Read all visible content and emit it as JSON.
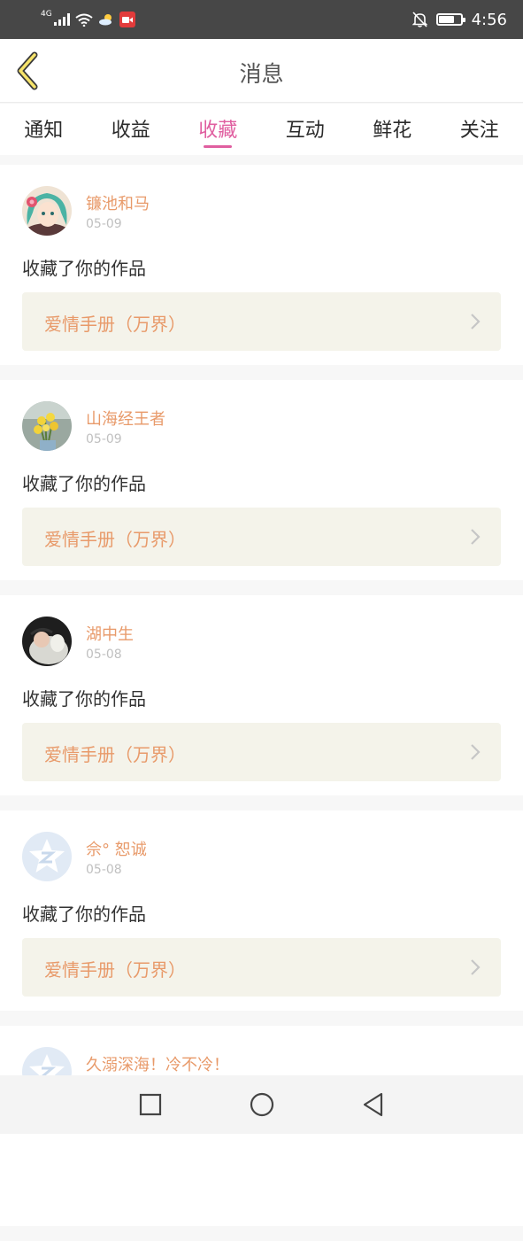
{
  "status_bar": {
    "network": "4G",
    "time": "4:56",
    "battery_level": 0.7
  },
  "header": {
    "title": "消息"
  },
  "tabs": [
    {
      "label": "通知",
      "active": false
    },
    {
      "label": "收益",
      "active": false
    },
    {
      "label": "收藏",
      "active": true
    },
    {
      "label": "互动",
      "active": false
    },
    {
      "label": "鲜花",
      "active": false
    },
    {
      "label": "关注",
      "active": false
    }
  ],
  "messages": [
    {
      "username": "镰池和马",
      "date": "05-09",
      "action": "收藏了你的作品",
      "work_title": "爱情手册（万界）",
      "avatar": "anime-girl"
    },
    {
      "username": "山海经王者",
      "date": "05-09",
      "action": "收藏了你的作品",
      "work_title": "爱情手册（万界）",
      "avatar": "flowers"
    },
    {
      "username": "湖中生",
      "date": "05-08",
      "action": "收藏了你的作品",
      "work_title": "爱情手册（万界）",
      "avatar": "baby-photo"
    },
    {
      "username": "佘° 恕诚",
      "date": "05-08",
      "action": "收藏了你的作品",
      "work_title": "爱情手册（万界）",
      "avatar": "default-star"
    },
    {
      "username": "久溺深海！冷不冷！",
      "date": "",
      "action": "",
      "work_title": "",
      "avatar": "default-star"
    }
  ],
  "colors": {
    "accent": "#e05fa0",
    "username": "#e89a6a",
    "work_box_bg": "#f4f3ea",
    "status_bar_bg": "#474747"
  }
}
